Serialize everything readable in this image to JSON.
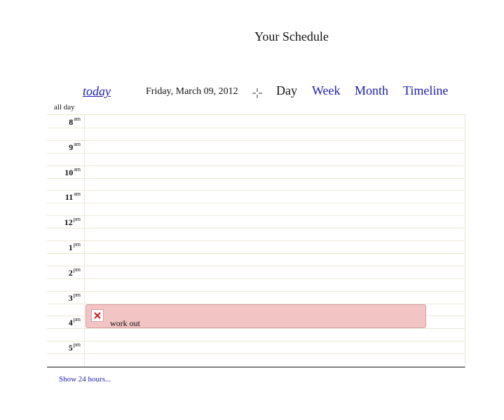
{
  "page_title": "Your Schedule",
  "toolbar": {
    "today_label": "today",
    "date_label": "Friday, March 09, 2012",
    "tabs": [
      {
        "label": "Day",
        "active": true
      },
      {
        "label": "Week",
        "active": false
      },
      {
        "label": "Month",
        "active": false
      },
      {
        "label": "Timeline",
        "active": false
      }
    ]
  },
  "allday_label": "all day",
  "hours": [
    {
      "hour": "8",
      "ampm": "am"
    },
    {
      "hour": "9",
      "ampm": "am"
    },
    {
      "hour": "10",
      "ampm": "am"
    },
    {
      "hour": "11",
      "ampm": "am"
    },
    {
      "hour": "12",
      "ampm": "pm"
    },
    {
      "hour": "1",
      "ampm": "pm"
    },
    {
      "hour": "2",
      "ampm": "pm"
    },
    {
      "hour": "3",
      "ampm": "pm"
    },
    {
      "hour": "4",
      "ampm": "pm"
    },
    {
      "hour": "5",
      "ampm": "pm"
    }
  ],
  "event": {
    "title": "work out",
    "icon": "close-icon",
    "color": "#f2c4c4"
  },
  "footer": {
    "show_24_label": "Show 24 hours..."
  },
  "colors": {
    "link": "#1b1bb0",
    "grid_line": "#ece7d6",
    "event_bg": "#f2c4c4"
  }
}
